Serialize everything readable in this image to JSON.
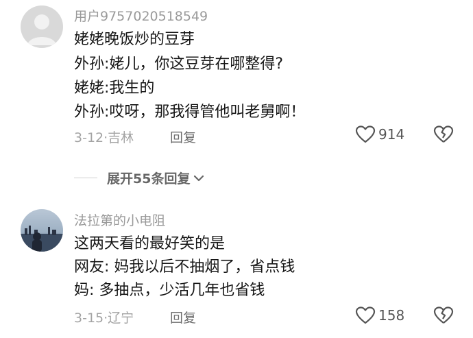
{
  "comments": [
    {
      "username": "用户9757020518549",
      "lines": [
        "姥姥晚饭炒的豆芽",
        "外孙:姥儿，你这豆芽在哪整得?",
        "姥姥:我生的",
        "外孙:哎呀，那我得管他叫老舅啊！"
      ],
      "meta": "3-12·吉林",
      "reply_label": "回复",
      "like_count": "914",
      "avatar_icon": "default-avatar-icon"
    },
    {
      "username": "法拉第的小电阻",
      "lines": [
        "这两天看的最好笑的是",
        "网友: 妈我以后不抽烟了，省点钱",
        "妈: 多抽点，少活几年也省钱"
      ],
      "meta": "3-15·辽宁",
      "reply_label": "回复",
      "like_count": "158",
      "avatar_icon": "photo-avatar"
    }
  ],
  "expand_replies": {
    "label": "展开55条回复",
    "icon": "chevron-down-icon"
  }
}
